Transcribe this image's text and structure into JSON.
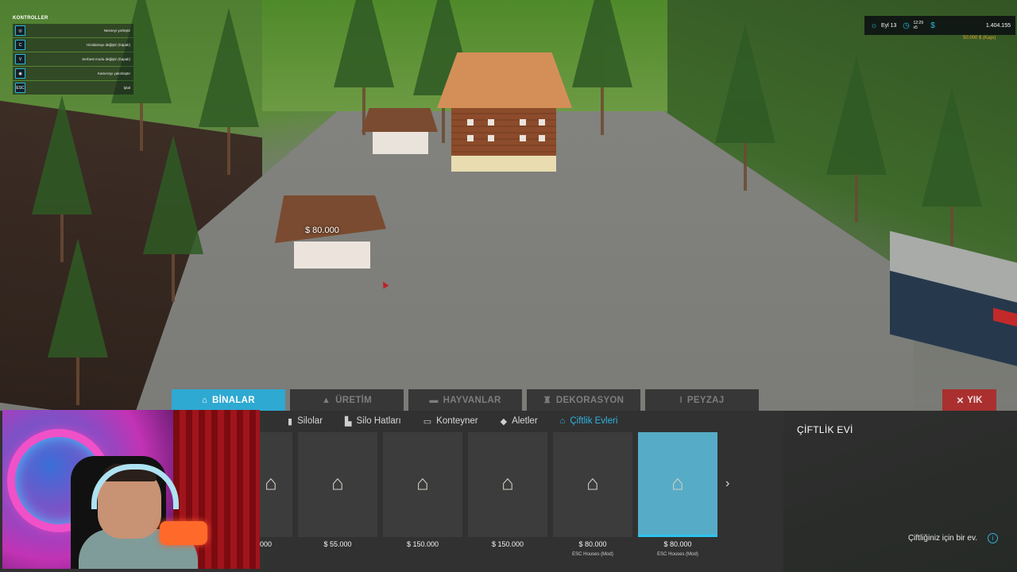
{
  "controls": {
    "title": "KONTROLLER",
    "items": [
      {
        "key": "",
        "label": "Nesneyi yerleştir"
      },
      {
        "key": "C",
        "label": "Hizalamayı değiştir (Kapalı)"
      },
      {
        "key": "V",
        "label": "Serbest modu değiştir (Kapalı)"
      },
      {
        "key": "",
        "label": "Kamerayı yakınlaştır"
      },
      {
        "key": "ESC",
        "label": "İptal"
      }
    ]
  },
  "hud": {
    "month": "Eyl 13",
    "time": "12:29",
    "speed": "x5",
    "money": "1.404.155",
    "loan": "50.000 $ (Kapı)"
  },
  "price_tag": "$ 80.000",
  "category_tabs": [
    {
      "label": "BİNALAR",
      "icon": "house-icon",
      "active": true
    },
    {
      "label": "ÜRETİM",
      "icon": "factory-icon",
      "active": false
    },
    {
      "label": "HAYVANLAR",
      "icon": "cow-icon",
      "active": false
    },
    {
      "label": "DEKORASYON",
      "icon": "lamp-icon",
      "active": false
    },
    {
      "label": "PEYZAJ",
      "icon": "thermometer-icon",
      "active": false
    }
  ],
  "demolish_label": "YIK",
  "sub_tabs": [
    {
      "label": "Silolar",
      "icon": "silo-icon"
    },
    {
      "label": "Silo Hatları",
      "icon": "silo-extension-icon"
    },
    {
      "label": "Konteyner",
      "icon": "container-icon"
    },
    {
      "label": "Aletler",
      "icon": "tools-icon"
    },
    {
      "label": "Çiftlik Evleri",
      "icon": "farmhouse-icon",
      "active": true
    }
  ],
  "items": [
    {
      "price": "000",
      "source": ""
    },
    {
      "price": "$ 55.000",
      "source": ""
    },
    {
      "price": "$ 150.000",
      "source": ""
    },
    {
      "price": "$ 150.000",
      "source": ""
    },
    {
      "price": "$ 80.000",
      "source": "ESC Houses (Mod)"
    },
    {
      "price": "$ 80.000",
      "source": "ESC Houses (Mod)",
      "selected": true
    }
  ],
  "detail": {
    "title": "ÇİFTLİK EVİ",
    "description": "Çiftliğiniz için bir ev."
  },
  "colors": {
    "accent": "#2ea9d2",
    "demolish": "#a9302f",
    "panel": "#313131"
  }
}
